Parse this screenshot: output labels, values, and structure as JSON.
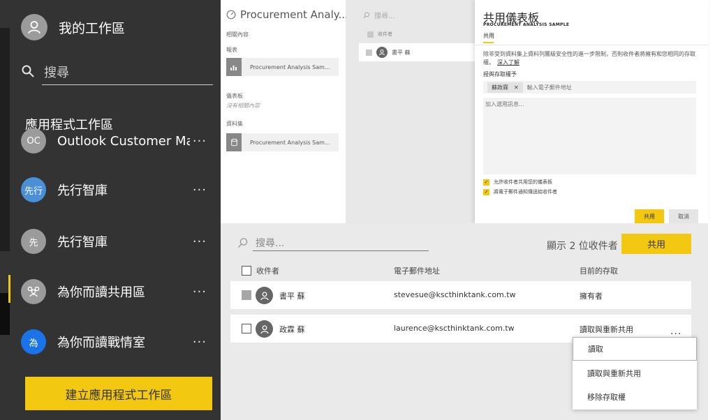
{
  "left_nav": {
    "title": "我的工作區",
    "search_placeholder": "搜尋",
    "section_label": "應用程式工作區",
    "items": [
      {
        "label": "Outlook Customer Man...",
        "initials": "OC",
        "color": "#9b9b9b"
      },
      {
        "label": "先行智庫",
        "initials": "先行",
        "color": "#4a90d9"
      },
      {
        "label": "先行智庫",
        "initials": "先",
        "color": "#9b9b9b"
      },
      {
        "label": "為你而讀共用區",
        "initials": "",
        "color": "#9b9b9b"
      },
      {
        "label": "為你而讀戰情室",
        "initials": "為",
        "color": "#1a73e8"
      }
    ],
    "more_label": "···",
    "create_button": "建立應用程式工作區"
  },
  "content_panel": {
    "title": "Procurement Analy...",
    "related_label": "相關內容",
    "reports_label": "報表",
    "report_name": "Procurement Analysis Sam...",
    "dashboards_label": "儀表板",
    "no_related": "沒有相關內容",
    "datasets_label": "資料集",
    "dataset_name": "Procurement Analysis Sam..."
  },
  "mini_recipients": {
    "search_placeholder": "搜尋...",
    "header": "收件者",
    "row_name": "書平 蘇"
  },
  "share_panel": {
    "title": "共用儀表板",
    "subtitle": "PROCUREMENT ANALYSIS SAMPLE",
    "tab": "共用",
    "info": "除非受到資料集上資料列層級安全性的進一步限制，否則收件者將擁有和您相同的存取權。",
    "learn_more": "深入了解",
    "grant_label": "授與存取權予",
    "chip": "蘇政霖",
    "chip_close": "✕",
    "email_placeholder": "輸入電子郵件地址",
    "message_placeholder": "加入選用訊息...",
    "check1": "允許收件者共用您的儀表板",
    "check2": "將電子郵件通知傳送給收件者",
    "share_button": "共用",
    "cancel_button": "取消"
  },
  "recipients": {
    "search_placeholder": "搜尋...",
    "count_label": "顯示 2 位收件者",
    "share_button": "共用",
    "columns": {
      "recipient": "收件者",
      "email": "電子郵件地址",
      "access": "目前的存取"
    },
    "rows": [
      {
        "name": "書平 蘇",
        "email": "stevesue@kscthinktank.com.tw",
        "access": "擁有者"
      },
      {
        "name": "政霖 蘇",
        "email": "laurence@kscthinktank.com.tw",
        "access": "讀取與重新共用"
      }
    ],
    "row_more": "..."
  },
  "access_menu": {
    "items": [
      "讀取",
      "讀取與重新共用",
      "移除存取權"
    ],
    "selected": "讀取"
  },
  "colors": {
    "accent": "#f2c811",
    "nav_bg": "#333333"
  }
}
